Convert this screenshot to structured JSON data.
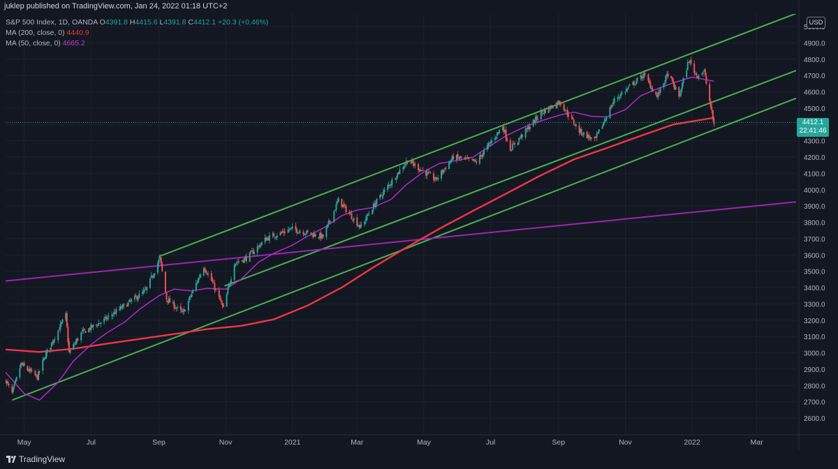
{
  "publish_line": "juklep published on TradingView.com, Jan 24, 2022 01:18 UTC+2",
  "legend": {
    "symbol": "S&P 500 Index, 1D, OANDA",
    "open_key": "O",
    "open": "4391.8",
    "high_key": "H",
    "high": "4415.6",
    "low_key": "L",
    "low": "4391.8",
    "close_key": "C",
    "close": "4412.1",
    "change": "+20.3 (+0.46%)",
    "ma200_label": "MA (200, close, 0)",
    "ma200_value": "4440.9",
    "ma50_label": "MA (50, close, 0)",
    "ma50_value": "4665.2"
  },
  "price_label": {
    "price": "4412.1",
    "countdown": "22:41:46"
  },
  "currency": "USD",
  "brand": "TradingView",
  "colors": {
    "background": "#131722",
    "grid": "#1e222d",
    "up": "#26a69a",
    "down": "#ef5350",
    "ma200": "#f23645",
    "ma50": "#b02bc9",
    "channel": "#4caf50",
    "trendline": "#9c27b0",
    "axis_text": "#b2b5be"
  },
  "chart_data": {
    "type": "candlestick",
    "ylim": [
      2550,
      5050
    ],
    "y_ticks": [
      2600,
      2700,
      2800,
      2900,
      3000,
      3100,
      3200,
      3300,
      3400,
      3500,
      3600,
      3700,
      3800,
      3900,
      4000,
      4100,
      4200,
      4300,
      4400,
      4500,
      4600,
      4700,
      4800,
      4900,
      5000
    ],
    "y_tick_labels": [
      "2600.0",
      "2700.0",
      "2800.0",
      "2900.0",
      "3000.0",
      "3100.0",
      "3200.0",
      "3300.0",
      "3400.0",
      "3500.0",
      "3600.0",
      "3700.0",
      "3800.0",
      "3900.0",
      "4000.0",
      "4100.0",
      "4200.0",
      "4300.0",
      "4400.0",
      "4500.0",
      "4600.0",
      "4700.0",
      "4800.0",
      "4900.0",
      "5000.0"
    ],
    "x_ticks": [
      {
        "label": "May",
        "date": "2020-05-01"
      },
      {
        "label": "Jul",
        "date": "2020-07-01"
      },
      {
        "label": "Sep",
        "date": "2020-09-01"
      },
      {
        "label": "Nov",
        "date": "2020-11-01"
      },
      {
        "label": "2021",
        "date": "2021-01-01"
      },
      {
        "label": "Mar",
        "date": "2021-03-01"
      },
      {
        "label": "May",
        "date": "2021-05-01"
      },
      {
        "label": "Jul",
        "date": "2021-07-01"
      },
      {
        "label": "Sep",
        "date": "2021-09-01"
      },
      {
        "label": "Nov",
        "date": "2021-11-01"
      },
      {
        "label": "2022",
        "date": "2022-01-01"
      },
      {
        "label": "Mar",
        "date": "2022-03-01"
      }
    ],
    "x_range": [
      "2020-04-14",
      "2022-04-06"
    ],
    "series": [
      {
        "name": "MA (200, close, 0)",
        "kind": "line",
        "points": [
          [
            "2020-04-14",
            3020
          ],
          [
            "2020-05-15",
            3005
          ],
          [
            "2020-06-15",
            3025
          ],
          [
            "2020-07-15",
            3055
          ],
          [
            "2020-08-15",
            3085
          ],
          [
            "2020-09-15",
            3115
          ],
          [
            "2020-10-15",
            3145
          ],
          [
            "2020-11-15",
            3165
          ],
          [
            "2020-12-15",
            3205
          ],
          [
            "2021-01-15",
            3290
          ],
          [
            "2021-02-15",
            3400
          ],
          [
            "2021-03-15",
            3520
          ],
          [
            "2021-04-15",
            3645
          ],
          [
            "2021-05-15",
            3760
          ],
          [
            "2021-06-15",
            3870
          ],
          [
            "2021-07-15",
            3975
          ],
          [
            "2021-08-15",
            4085
          ],
          [
            "2021-09-15",
            4185
          ],
          [
            "2021-10-15",
            4255
          ],
          [
            "2021-11-15",
            4330
          ],
          [
            "2021-12-15",
            4400
          ],
          [
            "2022-01-21",
            4440.9
          ]
        ]
      },
      {
        "name": "MA (50, close, 0)",
        "kind": "line",
        "points": [
          [
            "2020-04-14",
            2880
          ],
          [
            "2020-05-01",
            2750
          ],
          [
            "2020-05-15",
            2710
          ],
          [
            "2020-06-01",
            2820
          ],
          [
            "2020-06-15",
            2950
          ],
          [
            "2020-07-01",
            3050
          ],
          [
            "2020-07-15",
            3120
          ],
          [
            "2020-08-01",
            3190
          ],
          [
            "2020-08-15",
            3270
          ],
          [
            "2020-09-01",
            3350
          ],
          [
            "2020-09-15",
            3390
          ],
          [
            "2020-10-01",
            3380
          ],
          [
            "2020-10-15",
            3395
          ],
          [
            "2020-11-01",
            3390
          ],
          [
            "2020-11-15",
            3450
          ],
          [
            "2020-12-01",
            3555
          ],
          [
            "2020-12-15",
            3610
          ],
          [
            "2021-01-01",
            3660
          ],
          [
            "2021-01-15",
            3715
          ],
          [
            "2021-02-01",
            3775
          ],
          [
            "2021-02-15",
            3840
          ],
          [
            "2021-03-01",
            3875
          ],
          [
            "2021-03-15",
            3890
          ],
          [
            "2021-04-01",
            3940
          ],
          [
            "2021-04-15",
            4030
          ],
          [
            "2021-05-01",
            4110
          ],
          [
            "2021-05-15",
            4160
          ],
          [
            "2021-06-01",
            4180
          ],
          [
            "2021-06-15",
            4200
          ],
          [
            "2021-07-01",
            4270
          ],
          [
            "2021-07-15",
            4330
          ],
          [
            "2021-08-01",
            4385
          ],
          [
            "2021-08-15",
            4420
          ],
          [
            "2021-09-01",
            4455
          ],
          [
            "2021-09-15",
            4475
          ],
          [
            "2021-10-01",
            4450
          ],
          [
            "2021-10-15",
            4445
          ],
          [
            "2021-11-01",
            4490
          ],
          [
            "2021-11-15",
            4575
          ],
          [
            "2021-12-01",
            4620
          ],
          [
            "2021-12-15",
            4655
          ],
          [
            "2022-01-01",
            4690
          ],
          [
            "2022-01-21",
            4665.2
          ]
        ]
      }
    ],
    "lines": [
      {
        "kind": "channel_top",
        "from": [
          "2020-09-01",
          3590
        ],
        "to": [
          "2022-04-06",
          5080
        ]
      },
      {
        "kind": "channel_mid",
        "from": [
          "2020-10-31",
          3410
        ],
        "to": [
          "2022-04-06",
          4730
        ]
      },
      {
        "kind": "channel_bottom",
        "from": [
          "2020-04-20",
          2710
        ],
        "to": [
          "2022-04-06",
          4560
        ]
      },
      {
        "kind": "trendline",
        "from": [
          "2020-04-14",
          3440
        ],
        "to": [
          "2022-04-06",
          3925
        ]
      }
    ],
    "candle_anchors": [
      [
        "2020-04-14",
        2830
      ],
      [
        "2020-04-20",
        2750
      ],
      [
        "2020-04-28",
        2930
      ],
      [
        "2020-05-13",
        2850
      ],
      [
        "2020-05-20",
        2980
      ],
      [
        "2020-06-08",
        3230
      ],
      [
        "2020-06-11",
        3000
      ],
      [
        "2020-06-22",
        3120
      ],
      [
        "2020-07-13",
        3200
      ],
      [
        "2020-08-03",
        3300
      ],
      [
        "2020-08-20",
        3380
      ],
      [
        "2020-09-02",
        3580
      ],
      [
        "2020-09-08",
        3330
      ],
      [
        "2020-09-23",
        3240
      ],
      [
        "2020-10-12",
        3530
      ],
      [
        "2020-10-20",
        3430
      ],
      [
        "2020-10-30",
        3270
      ],
      [
        "2020-11-09",
        3550
      ],
      [
        "2020-11-20",
        3580
      ],
      [
        "2020-12-08",
        3700
      ],
      [
        "2020-12-31",
        3760
      ],
      [
        "2021-01-29",
        3710
      ],
      [
        "2021-02-12",
        3935
      ],
      [
        "2021-03-04",
        3770
      ],
      [
        "2021-03-18",
        3920
      ],
      [
        "2021-04-16",
        4180
      ],
      [
        "2021-05-12",
        4060
      ],
      [
        "2021-05-28",
        4200
      ],
      [
        "2021-06-18",
        4170
      ],
      [
        "2021-07-12",
        4390
      ],
      [
        "2021-07-19",
        4250
      ],
      [
        "2021-08-16",
        4470
      ],
      [
        "2021-09-02",
        4540
      ],
      [
        "2021-09-20",
        4360
      ],
      [
        "2021-10-04",
        4300
      ],
      [
        "2021-10-22",
        4550
      ],
      [
        "2021-11-18",
        4705
      ],
      [
        "2021-11-30",
        4570
      ],
      [
        "2021-12-10",
        4710
      ],
      [
        "2021-12-20",
        4570
      ],
      [
        "2021-12-29",
        4795
      ],
      [
        "2022-01-05",
        4700
      ],
      [
        "2022-01-12",
        4725
      ],
      [
        "2022-01-21",
        4398
      ]
    ]
  }
}
